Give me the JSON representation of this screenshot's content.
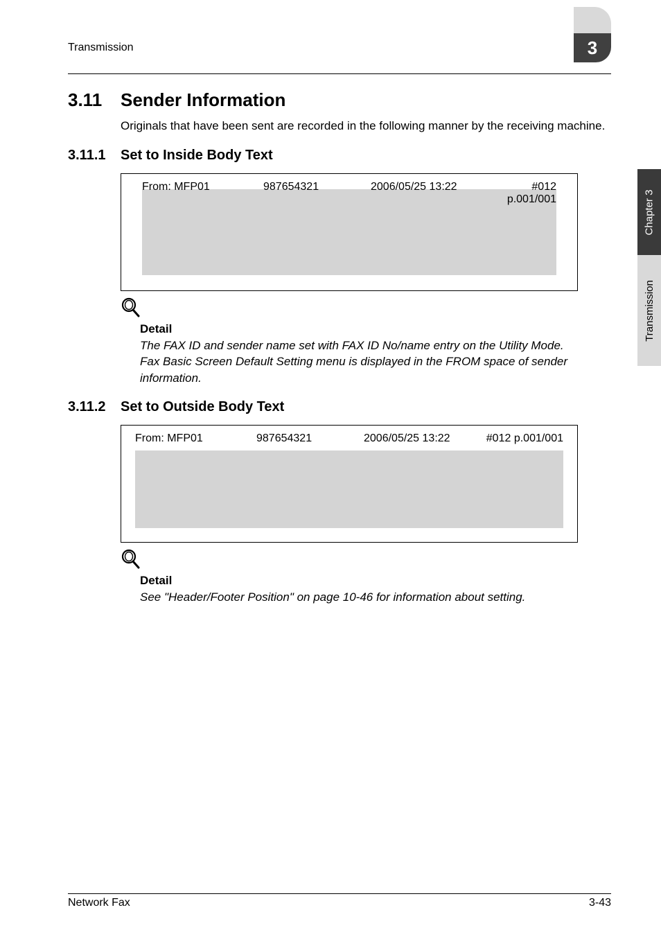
{
  "runningHead": "Transmission",
  "chapterTabNumber": "3",
  "sideTab": {
    "dark": "Chapter 3",
    "light": "Transmission"
  },
  "section": {
    "num": "3.11",
    "title": "Sender Information",
    "intro": "Originals that have been sent are recorded in the following manner by the receiving machine."
  },
  "sub1": {
    "num": "3.11.1",
    "title": "Set to Inside Body Text",
    "header": {
      "from": "From: MFP01",
      "id": "987654321",
      "datetime": "2006/05/25 13:22",
      "page": "#012 p.001/001"
    },
    "detailLabel": "Detail",
    "detailText": "The FAX ID and sender name set with FAX ID No/name entry on the Utility Mode. Fax Basic Screen Default Setting menu is displayed in the FROM space of sender information."
  },
  "sub2": {
    "num": "3.11.2",
    "title": "Set to Outside Body Text",
    "header": {
      "from": "From: MFP01",
      "id": "987654321",
      "datetime": "2006/05/25 13:22",
      "page": "#012 p.001/001"
    },
    "detailLabel": "Detail",
    "detailText": "See \"Header/Footer Position\" on page 10-46 for information about setting."
  },
  "footer": {
    "left": "Network Fax",
    "right": "3-43"
  }
}
